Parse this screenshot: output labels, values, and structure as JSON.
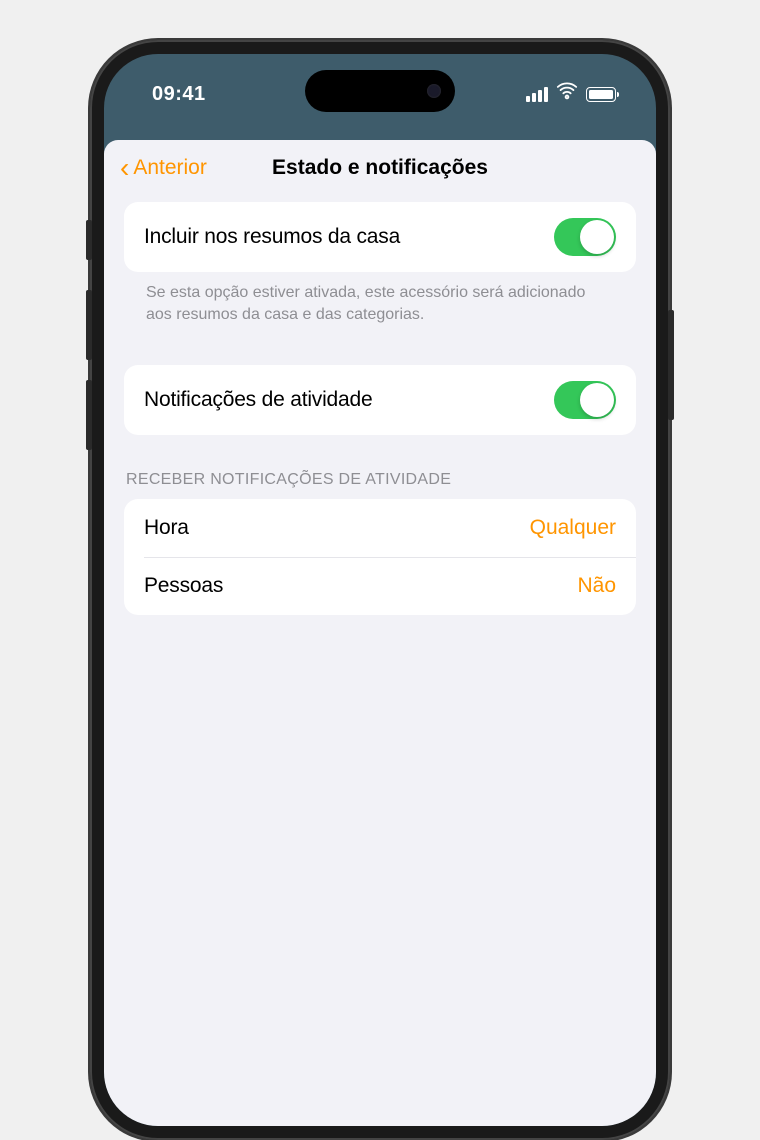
{
  "status": {
    "time": "09:41"
  },
  "nav": {
    "back_label": "Anterior",
    "title": "Estado e notificações"
  },
  "settings": {
    "include_summary": {
      "label": "Incluir nos resumos da casa",
      "footer": "Se esta opção estiver ativada, este acessório será adicionado aos resumos da casa e das categorias.",
      "enabled": true
    },
    "activity_notifications": {
      "label": "Notificações de atividade",
      "enabled": true
    }
  },
  "receive_section": {
    "header": "RECEBER NOTIFICAÇÕES DE ATIVIDADE",
    "rows": [
      {
        "label": "Hora",
        "value": "Qualquer"
      },
      {
        "label": "Pessoas",
        "value": "Não"
      }
    ]
  }
}
